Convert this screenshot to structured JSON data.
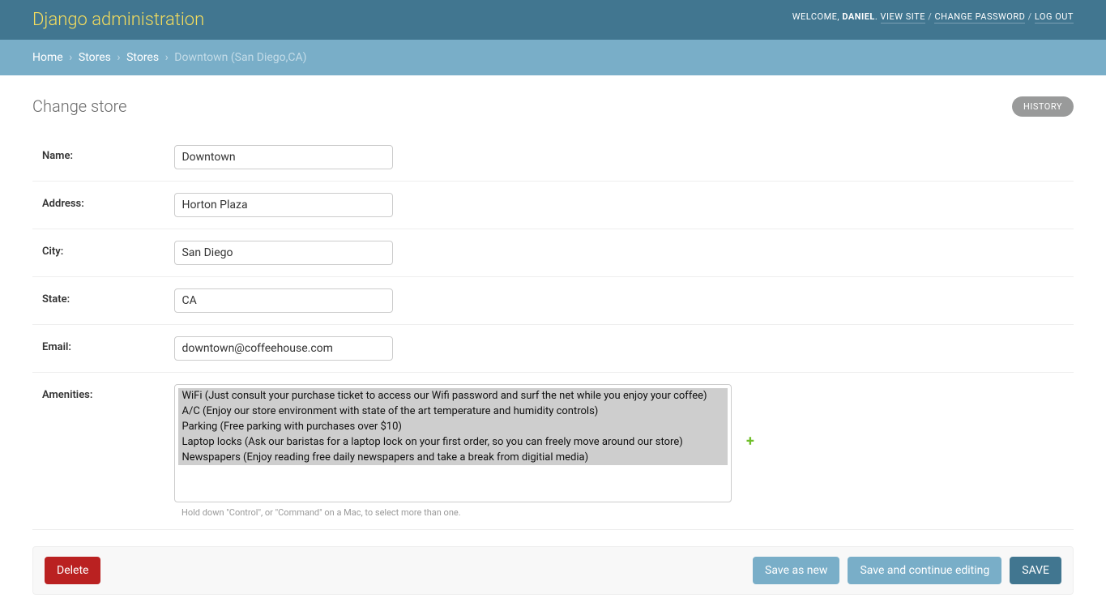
{
  "header": {
    "site_title": "Django administration",
    "welcome": "WELCOME,",
    "username": "DANIEL",
    "view_site": "VIEW SITE",
    "change_password": "CHANGE PASSWORD",
    "log_out": "LOG OUT"
  },
  "breadcrumbs": {
    "home": "Home",
    "app": "Stores",
    "model": "Stores",
    "object": "Downtown (San Diego,CA)"
  },
  "page": {
    "title": "Change store",
    "history": "HISTORY"
  },
  "fields": {
    "name": {
      "label": "Name:",
      "value": "Downtown"
    },
    "address": {
      "label": "Address:",
      "value": "Horton Plaza"
    },
    "city": {
      "label": "City:",
      "value": "San Diego"
    },
    "state": {
      "label": "State:",
      "value": "CA"
    },
    "email": {
      "label": "Email:",
      "value": "downtown@coffeehouse.com"
    },
    "amenities": {
      "label": "Amenities:",
      "options": [
        "WiFi (Just consult your purchase ticket to access our Wifi password and surf the net while you enjoy your coffee)",
        "A/C (Enjoy our store environment with state of the art temperature and humidity controls)",
        "Parking (Free parking with purchases over $10)",
        "Laptop locks (Ask our baristas for a laptop lock on your first order, so you can freely move around our store)",
        "Newspapers (Enjoy reading free daily newspapers and take a break from digitial media)"
      ],
      "help": "Hold down \"Control\", or \"Command\" on a Mac, to select more than one."
    }
  },
  "actions": {
    "delete": "Delete",
    "save_as_new": "Save as new",
    "save_continue": "Save and continue editing",
    "save": "SAVE",
    "add_icon": "+"
  }
}
